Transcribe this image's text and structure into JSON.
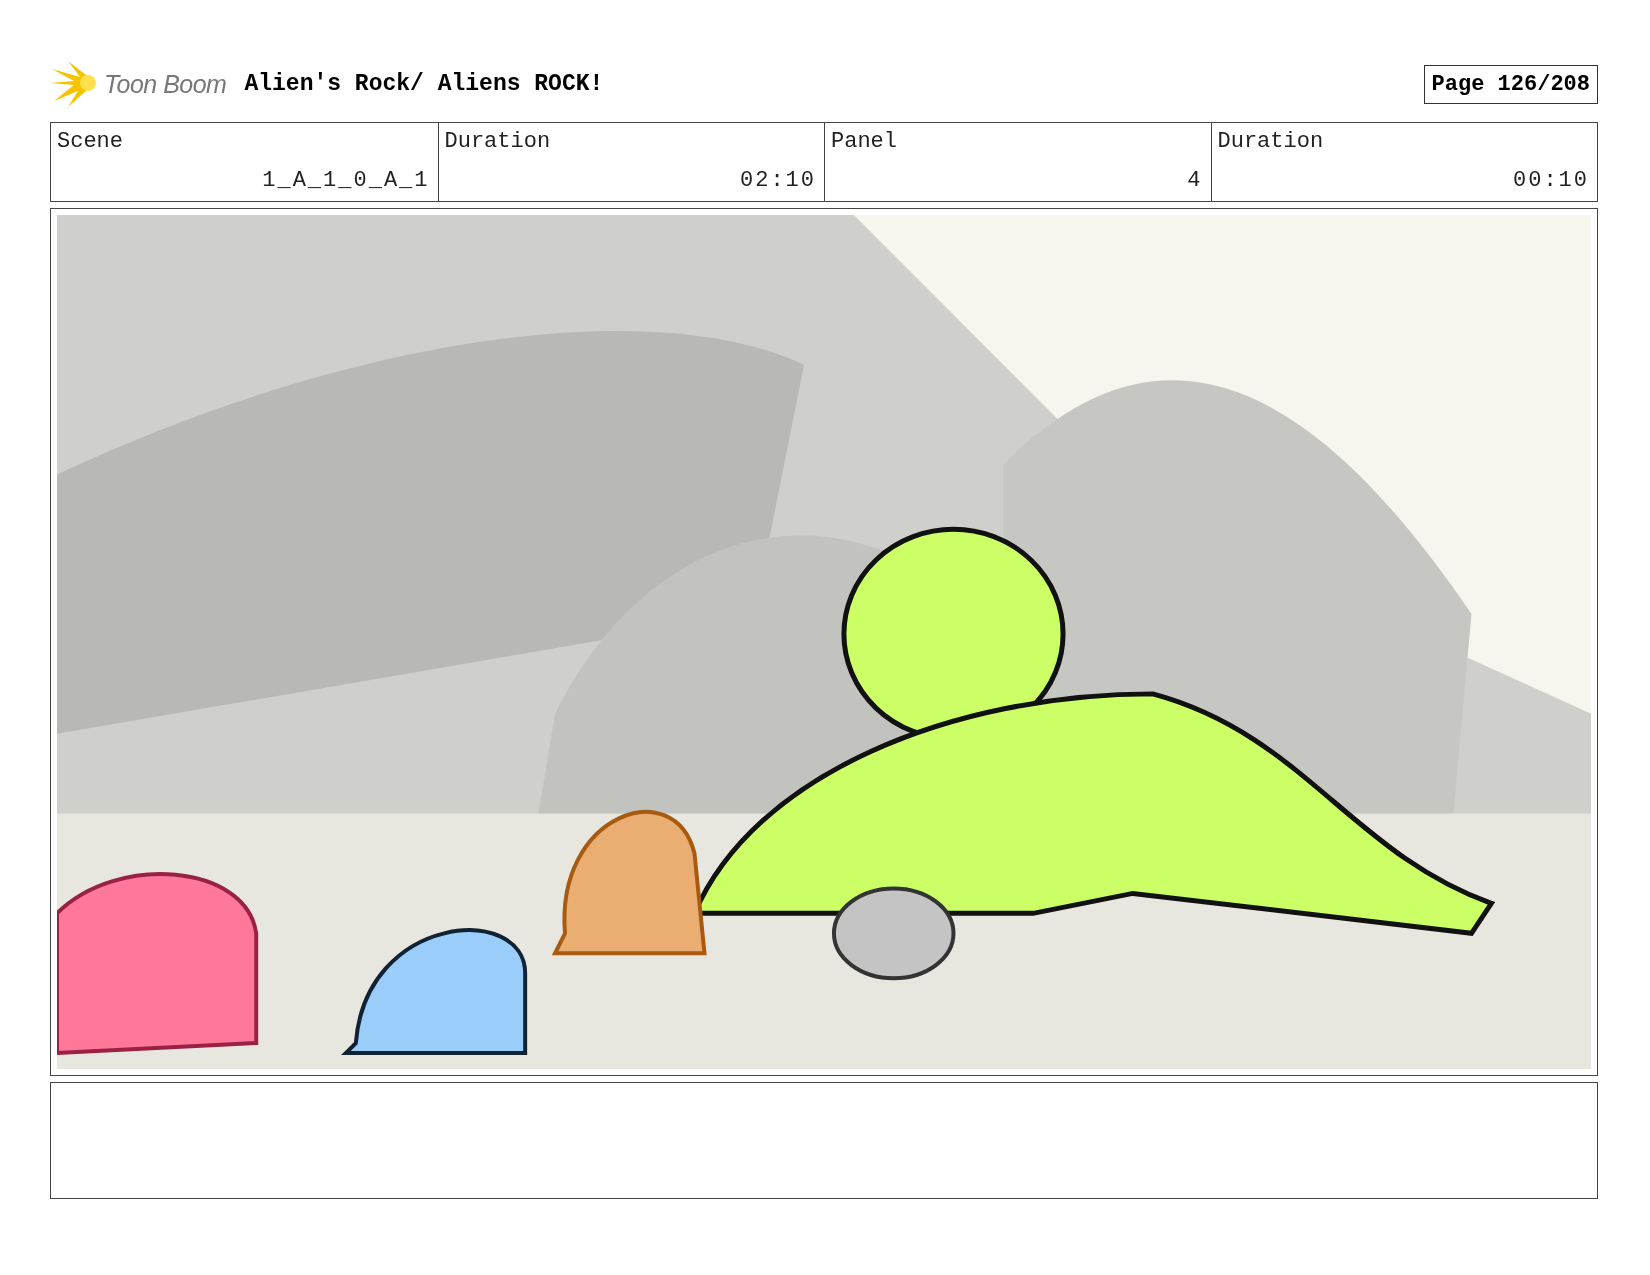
{
  "header": {
    "logo": "Toon Boom",
    "title": "Alien's Rock/ Aliens ROCK!",
    "page": "Page 126/208"
  },
  "table": {
    "columns": [
      "Scene",
      "Duration",
      "Panel",
      "Duration"
    ],
    "rows": [
      [
        "1_A_1_0_A_1",
        "02:10",
        "4",
        "00:10"
      ]
    ]
  }
}
